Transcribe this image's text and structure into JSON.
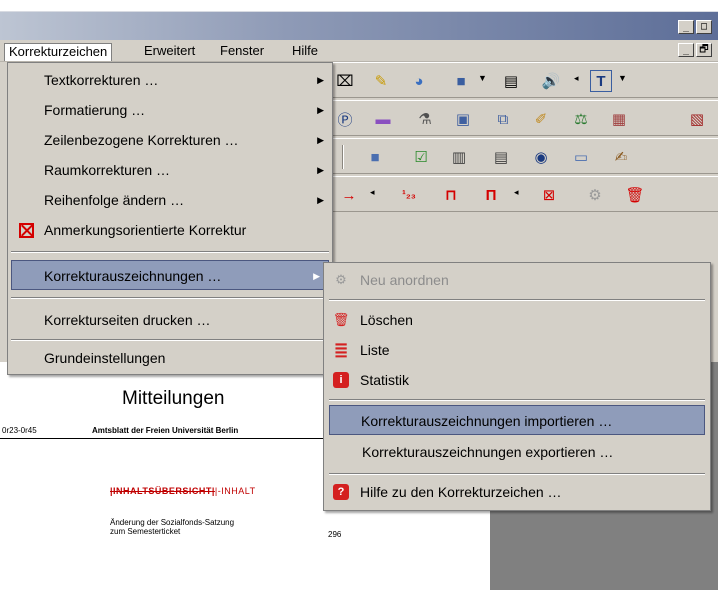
{
  "window": {
    "min_glyph": "_",
    "max_glyph": "□",
    "restore_glyph": "🗗"
  },
  "menubar": {
    "items": [
      "Korrekturzeichen",
      "Erweitert",
      "Fenster",
      "Hilfe"
    ]
  },
  "menu": {
    "items": [
      {
        "label": "Textkorrekturen …",
        "submenu": "▶"
      },
      {
        "label": "Formatierung …",
        "submenu": "▶"
      },
      {
        "label": "Zeilenbezogene Korrekturen …",
        "submenu": "▶"
      },
      {
        "label": "Raumkorrekturen …",
        "submenu": "▶"
      },
      {
        "label": "Reihenfolge ändern …",
        "submenu": "▶"
      },
      {
        "label": "Anmerkungsorientierte Korrektur"
      },
      {
        "label": "Korrekturauszeichnungen …",
        "submenu": "▶"
      },
      {
        "label": "Korrekturseiten drucken …"
      },
      {
        "label": "Grundeinstellungen"
      }
    ]
  },
  "submenu": {
    "items": [
      {
        "label": "Neu anordnen",
        "icon": "gear-icon",
        "glyph": "⚙"
      },
      {
        "label": "Löschen",
        "icon": "trash-icon",
        "glyph": "🗑"
      },
      {
        "label": "Liste",
        "icon": "list-icon",
        "glyph": "≣"
      },
      {
        "label": "Statistik",
        "icon": "info-icon",
        "glyph": "i"
      },
      {
        "label": "Korrekturauszeichnungen importieren …"
      },
      {
        "label": "Korrekturauszeichnungen exportieren …"
      },
      {
        "label": "Hilfe zu den Korrekturzeichen …",
        "icon": "help-icon",
        "glyph": "?"
      }
    ]
  },
  "toolbar": {
    "row1": [
      "⌧",
      "✎",
      "◕",
      "■",
      "▤",
      "🔊",
      "T"
    ],
    "row2": [
      "Ⓟ",
      "▬",
      "⚗",
      "▣",
      "⧉",
      "✐",
      "⚖",
      "▦",
      "▧"
    ],
    "row3": [
      "■",
      "☑",
      "▥",
      "▤",
      "◉",
      "▭",
      "✍"
    ],
    "row4": [
      "→",
      "¹₂₃",
      "⊓",
      "Π",
      "⊠",
      "⚙",
      "🗑"
    ]
  },
  "document": {
    "title": "Mitteilungen",
    "issue_number": "0r23-0r45",
    "header": "Amtsblatt der Freien Universität Berlin",
    "toc_struck": "INHALTSÜBERSICHT",
    "toc_replacement": "INHALT",
    "item_line1": "Änderung der Sozialfonds-Satzung",
    "item_line2": "zum Semesterticket",
    "page": "296"
  },
  "colors": {
    "menu_bg": "#d4d0c8",
    "highlight": "#8f9cba",
    "accent_red": "#d40000"
  }
}
